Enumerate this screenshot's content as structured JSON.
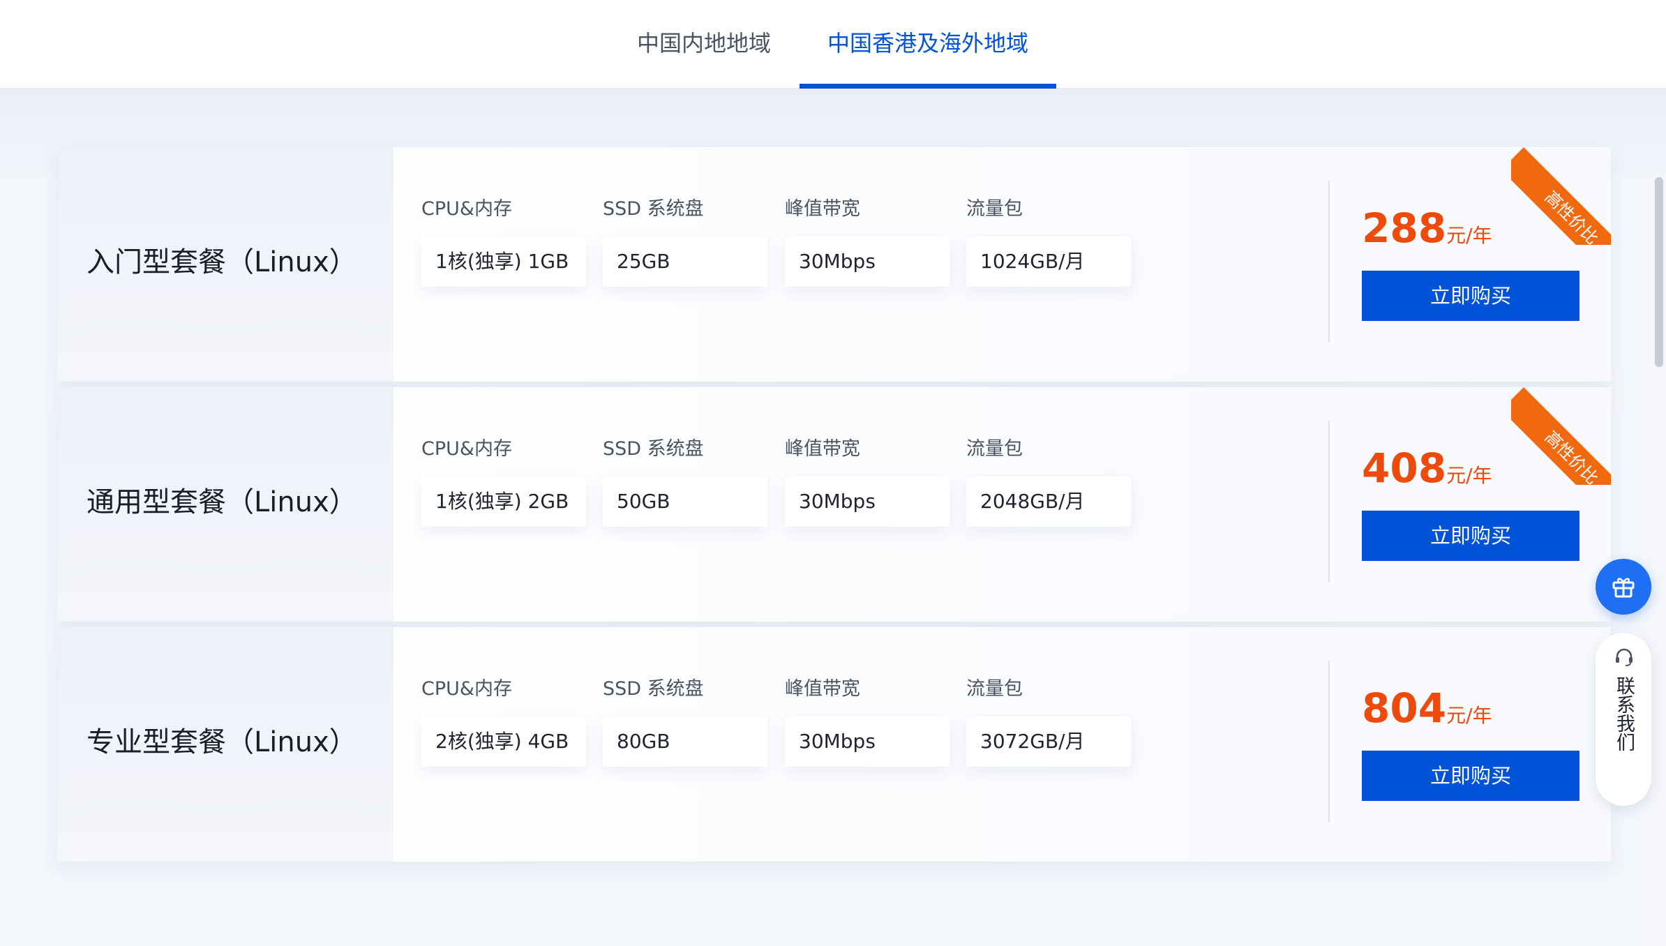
{
  "tabs": [
    {
      "label": "中国内地地域",
      "active": false
    },
    {
      "label": "中国香港及海外地域",
      "active": true
    }
  ],
  "spec_labels": [
    "CPU&内存",
    "SSD 系统盘",
    "峰值带宽",
    "流量包"
  ],
  "packages": [
    {
      "name": "入门型套餐（Linux）",
      "specs": [
        "1核(独享) 1GB",
        "25GB",
        "30Mbps",
        "1024GB/月"
      ],
      "price": "288",
      "price_unit": "元/年",
      "button": "立即购买",
      "ribbon": "高性价比"
    },
    {
      "name": "通用型套餐（Linux）",
      "specs": [
        "1核(独享) 2GB",
        "50GB",
        "30Mbps",
        "2048GB/月"
      ],
      "price": "408",
      "price_unit": "元/年",
      "button": "立即购买",
      "ribbon": "高性价比"
    },
    {
      "name": "专业型套餐（Linux）",
      "specs": [
        "2核(独享) 4GB",
        "80GB",
        "30Mbps",
        "3072GB/月"
      ],
      "price": "804",
      "price_unit": "元/年",
      "button": "立即购买"
    }
  ],
  "contact": {
    "label": "联系我们"
  },
  "icons": {
    "gift": "gift-icon",
    "headset": "headset-icon"
  },
  "colors": {
    "accent": "#0052d9",
    "price": "#ed4a0c",
    "ribbon": "#f26a10"
  }
}
